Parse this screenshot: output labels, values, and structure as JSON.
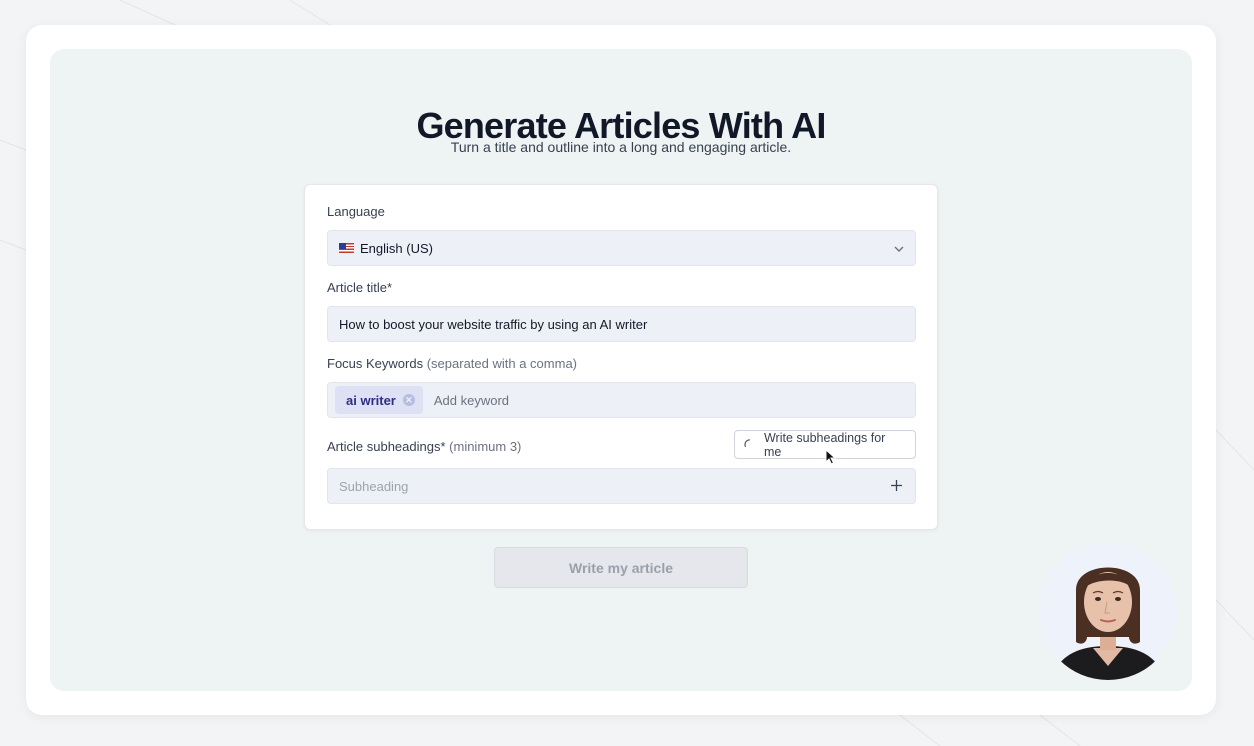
{
  "header": {
    "title": "Generate Articles With AI",
    "subtitle": "Turn a title and outline into a long and engaging article."
  },
  "form": {
    "language": {
      "label": "Language",
      "value": "English (US)",
      "flag_icon": "us-flag-icon"
    },
    "article_title": {
      "label": "Article title*",
      "value": "How to boost your website traffic by using an AI writer"
    },
    "focus_keywords": {
      "label": "Focus Keywords",
      "hint": "(separated with a comma)",
      "chips": [
        "ai writer"
      ],
      "placeholder": "Add keyword"
    },
    "subheadings": {
      "label": "Article subheadings*",
      "hint": "(minimum 3)",
      "ai_button_label": "Write subheadings for me",
      "placeholder": "Subheading"
    }
  },
  "actions": {
    "submit_label": "Write my article"
  },
  "colors": {
    "accent": "#312e81",
    "panel_bg": "#eef3f3",
    "field_bg": "#eef0f7"
  }
}
